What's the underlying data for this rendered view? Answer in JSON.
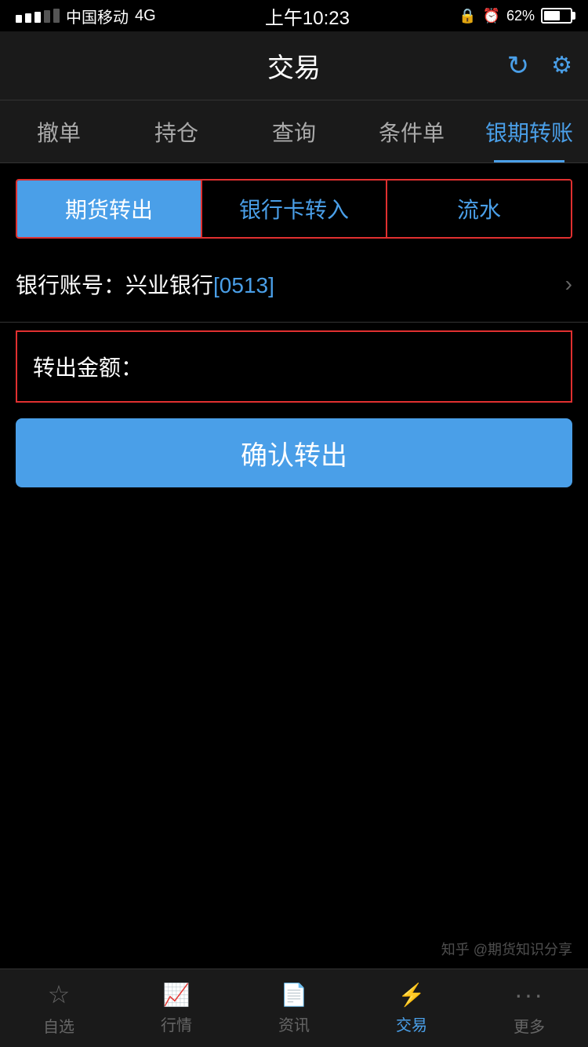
{
  "statusBar": {
    "carrier": "中国移动",
    "network": "4G",
    "time": "上午10:23",
    "battery": "62%"
  },
  "header": {
    "title": "交易",
    "refreshIcon": "↻",
    "settingsIcon": "⚙"
  },
  "navTabs": [
    {
      "id": "cancel",
      "label": "撤单",
      "active": false
    },
    {
      "id": "position",
      "label": "持仓",
      "active": false
    },
    {
      "id": "query",
      "label": "查询",
      "active": false
    },
    {
      "id": "conditional",
      "label": "条件单",
      "active": false
    },
    {
      "id": "transfer",
      "label": "银期转账",
      "active": true
    }
  ],
  "subTabs": [
    {
      "id": "futures-out",
      "label": "期货转出",
      "active": true
    },
    {
      "id": "bank-in",
      "label": "银行卡转入",
      "active": false
    },
    {
      "id": "history",
      "label": "流水",
      "active": false
    }
  ],
  "bankAccount": {
    "label": "银行账号：兴业银行",
    "accountSuffix": "[0513]"
  },
  "amountField": {
    "label": "转出金额：",
    "placeholder": ""
  },
  "confirmButton": {
    "label": "确认转出"
  },
  "bottomNav": [
    {
      "id": "watchlist",
      "label": "自选",
      "icon": "☆",
      "active": false
    },
    {
      "id": "market",
      "label": "行情",
      "icon": "📈",
      "active": false
    },
    {
      "id": "news",
      "label": "资讯",
      "icon": "📄",
      "active": false
    },
    {
      "id": "trade",
      "label": "交易",
      "icon": "⚡",
      "active": true
    },
    {
      "id": "more",
      "label": "更多",
      "icon": "···",
      "active": false
    }
  ],
  "watermark": "知乎 @期货知识分享"
}
